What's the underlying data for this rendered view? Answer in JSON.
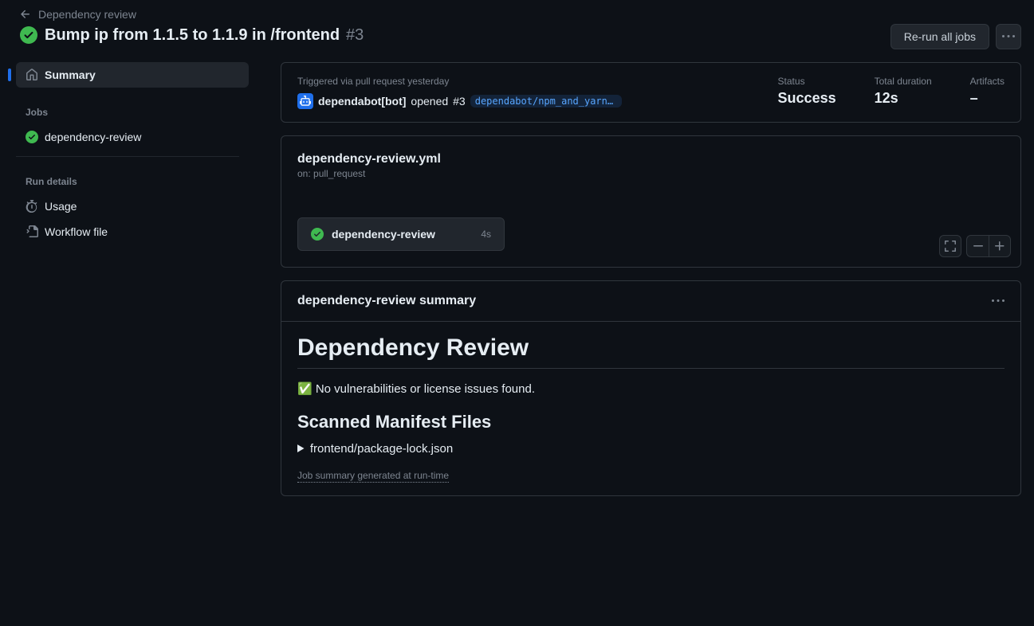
{
  "breadcrumb": {
    "back_label": "Dependency review"
  },
  "title": "Bump ip from 1.1.5 to 1.1.9 in /frontend",
  "title_number": "#3",
  "actions": {
    "rerun": "Re-run all jobs"
  },
  "sidebar": {
    "summary": "Summary",
    "jobs_header": "Jobs",
    "jobs": [
      {
        "label": "dependency-review"
      }
    ],
    "run_details_header": "Run details",
    "usage": "Usage",
    "workflow_file": "Workflow file"
  },
  "trigger": {
    "description": "Triggered via pull request yesterday",
    "actor": "dependabot[bot]",
    "action_text": "opened",
    "pr_number": "#3",
    "branch": "dependabot/npm_and_yarn/…",
    "status_label": "Status",
    "status_value": "Success",
    "duration_label": "Total duration",
    "duration_value": "12s",
    "artifacts_label": "Artifacts",
    "artifacts_value": "–"
  },
  "workflow": {
    "file": "dependency-review.yml",
    "on": "on: pull_request",
    "job_name": "dependency-review",
    "job_duration": "4s"
  },
  "summary": {
    "header": "dependency-review summary",
    "h1": "Dependency Review",
    "status_line": "✅ No vulnerabilities or license issues found.",
    "h2": "Scanned Manifest Files",
    "manifest": "frontend/package-lock.json",
    "footer": "Job summary generated at run-time"
  }
}
